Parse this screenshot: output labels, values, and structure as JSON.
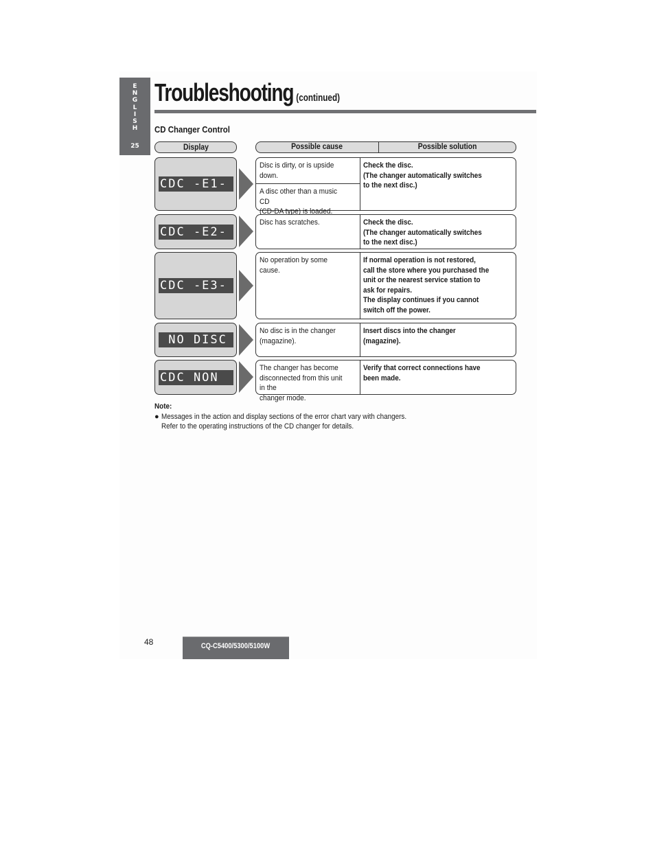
{
  "language_tab": {
    "letters": [
      "E",
      "N",
      "G",
      "L",
      "I",
      "S",
      "H"
    ],
    "section_number": "25"
  },
  "header": {
    "title": "Troubleshooting",
    "subtitle": "(continued)"
  },
  "section": {
    "title": "CD Changer Control"
  },
  "table": {
    "headers": {
      "display": "Display",
      "cause": "Possible cause",
      "solution": "Possible solution"
    },
    "rows": [
      {
        "display": "CDC -E1-",
        "causes": [
          "Disc is dirty, or is upside down.",
          "A disc other than a music CD\n(CD-DA type) is loaded."
        ],
        "solution": "Check the disc.\n(The changer automatically switches\nto the next disc.)"
      },
      {
        "display": "CDC -E2-",
        "causes": [
          "Disc has scratches."
        ],
        "solution": "Check the disc.\n(The changer automatically switches\nto the next disc.)"
      },
      {
        "display": "CDC -E3-",
        "causes": [
          "No operation by some cause."
        ],
        "solution": "If normal operation is not restored,\ncall the store where you purchased the\nunit or the nearest service station to\nask for repairs.\nThe display continues if you cannot\nswitch off the power."
      },
      {
        "display": " NO DISC",
        "causes": [
          "No disc is in the changer\n(magazine)."
        ],
        "solution": "Insert discs into the changer\n(magazine)."
      },
      {
        "display": "CDC NON",
        "causes": [
          "The changer has become\ndisconnected from this unit in the\nchanger mode."
        ],
        "solution": "Verify that correct connections have\nbeen made."
      }
    ]
  },
  "note": {
    "label": "Note:",
    "bullet": "●",
    "line1": "Messages in the action and display sections of the error chart vary with changers.",
    "line2": "Refer to the operating instructions of the CD changer for details."
  },
  "footer": {
    "page_number": "48",
    "model": "CQ-C5400/5300/5100W"
  }
}
